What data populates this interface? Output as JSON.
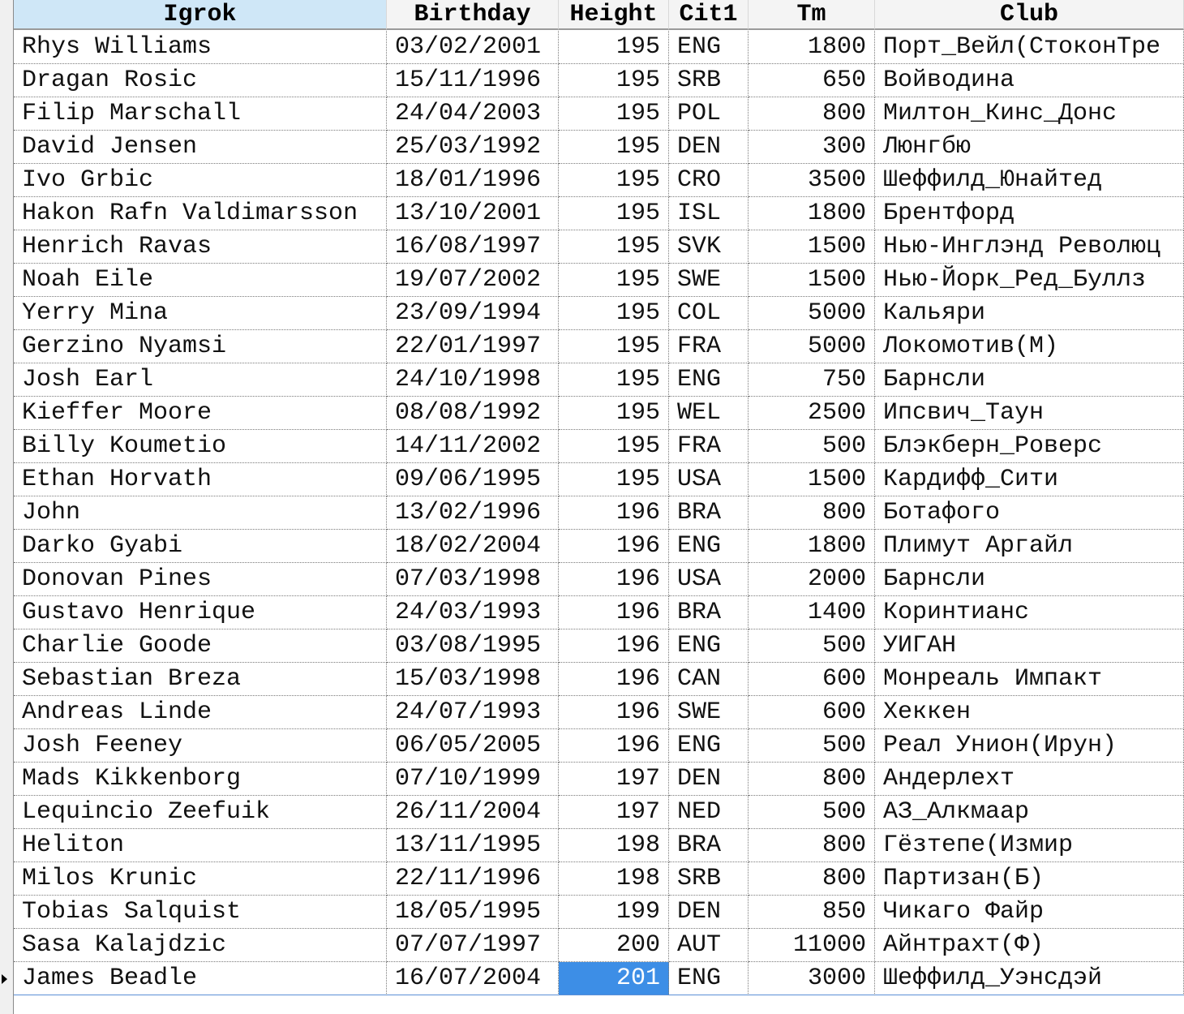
{
  "columns": [
    "Igrok",
    "Birthday",
    "Height",
    "Cit1",
    "Tm",
    "Club"
  ],
  "rows": [
    [
      "Rhys Williams",
      "03/02/2001",
      "195",
      "ENG",
      "1800",
      "Порт_Вейл(СтоконТре"
    ],
    [
      "Dragan Rosic",
      "15/11/1996",
      "195",
      "SRB",
      "650",
      "Войводина"
    ],
    [
      "Filip Marschall",
      "24/04/2003",
      "195",
      "POL",
      "800",
      "Милтон_Кинс_Донс"
    ],
    [
      "David Jensen",
      "25/03/1992",
      "195",
      "DEN",
      "300",
      "Люнгбю"
    ],
    [
      "Ivo Grbic",
      "18/01/1996",
      "195",
      "CRO",
      "3500",
      "Шеффилд_Юнайтед"
    ],
    [
      "Hakon Rafn Valdimarsson",
      "13/10/2001",
      "195",
      "ISL",
      "1800",
      "Брентфорд"
    ],
    [
      "Henrich Ravas",
      "16/08/1997",
      "195",
      "SVK",
      "1500",
      "Нью-Инглэнд Революц"
    ],
    [
      "Noah Eile",
      "19/07/2002",
      "195",
      "SWE",
      "1500",
      "Нью-Йорк_Ред_Буллз"
    ],
    [
      "Yerry Mina",
      "23/09/1994",
      "195",
      "COL",
      "5000",
      "Кальяри"
    ],
    [
      "Gerzino Nyamsi",
      "22/01/1997",
      "195",
      "FRA",
      "5000",
      "Локомотив(М)"
    ],
    [
      "Josh Earl",
      "24/10/1998",
      "195",
      "ENG",
      "750",
      "Барнсли"
    ],
    [
      "Kieffer Moore",
      "08/08/1992",
      "195",
      "WEL",
      "2500",
      "Ипсвич_Таун"
    ],
    [
      "Billy Koumetio",
      "14/11/2002",
      "195",
      "FRA",
      "500",
      "Блэкберн_Роверс"
    ],
    [
      "Ethan Horvath",
      "09/06/1995",
      "195",
      "USA",
      "1500",
      "Кардифф_Сити"
    ],
    [
      "John",
      "13/02/1996",
      "196",
      "BRA",
      "800",
      "Ботафого"
    ],
    [
      "Darko Gyabi",
      "18/02/2004",
      "196",
      "ENG",
      "1800",
      "Плимут Аргайл"
    ],
    [
      "Donovan Pines",
      "07/03/1998",
      "196",
      "USA",
      "2000",
      "Барнсли"
    ],
    [
      "Gustavo Henrique",
      "24/03/1993",
      "196",
      "BRA",
      "1400",
      "Коринтианс"
    ],
    [
      "Charlie Goode",
      "03/08/1995",
      "196",
      "ENG",
      "500",
      "УИГАН"
    ],
    [
      "Sebastian Breza",
      "15/03/1998",
      "196",
      "CAN",
      "600",
      "Монреаль Импакт"
    ],
    [
      "Andreas Linde",
      "24/07/1993",
      "196",
      "SWE",
      "600",
      "Хеккен"
    ],
    [
      "Josh Feeney",
      "06/05/2005",
      "196",
      "ENG",
      "500",
      "Реал Унион(Ирун)"
    ],
    [
      "Mads Kikkenborg",
      "07/10/1999",
      "197",
      "DEN",
      "800",
      "Андерлехт"
    ],
    [
      "Lequincio Zeefuik",
      "26/11/2004",
      "197",
      "NED",
      "500",
      "АЗ_Алкмаар"
    ],
    [
      "Heliton",
      "13/11/1995",
      "198",
      "BRA",
      "800",
      "Гёзтепе(Измир"
    ],
    [
      "Milos Krunic",
      "22/11/1996",
      "198",
      "SRB",
      "800",
      "Партизан(Б)"
    ],
    [
      "Tobias Salquist",
      "18/05/1995",
      "199",
      "DEN",
      "850",
      "Чикаго Файр"
    ],
    [
      "Sasa Kalajdzic",
      "07/07/1997",
      "200",
      "AUT",
      "11000",
      "Айнтрахт(Ф)"
    ],
    [
      "James Beadle",
      "16/07/2004",
      "201",
      "ENG",
      "3000",
      "Шеффилд_Уэнсдэй"
    ]
  ],
  "numeric_columns": [
    2,
    4
  ],
  "current_row": 28,
  "active_column": 2,
  "sorted_column": 0,
  "colors": {
    "active_cell": "#3d8ee6",
    "sorted_header": "#cfe7f7"
  }
}
